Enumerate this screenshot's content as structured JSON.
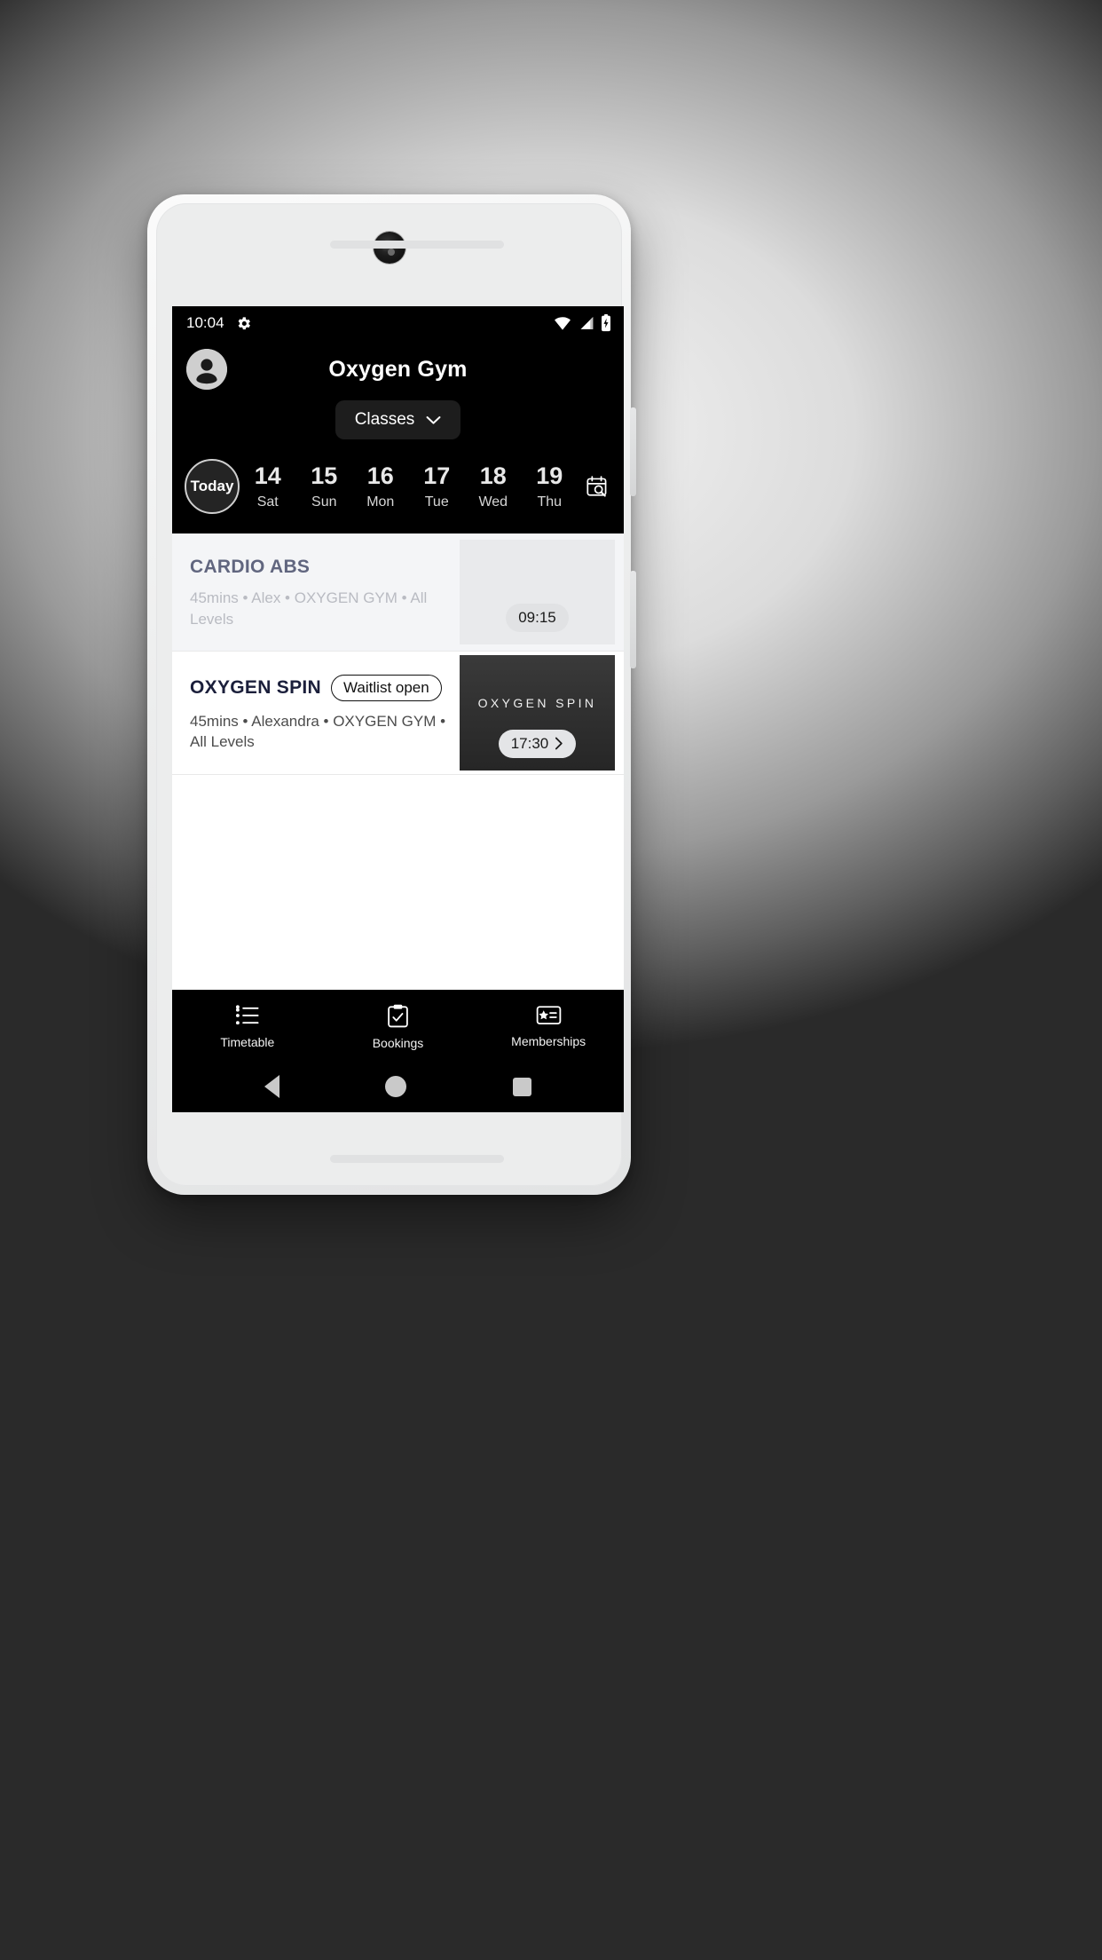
{
  "status_bar": {
    "time": "10:04",
    "icons": [
      "gear-icon",
      "wifi-icon",
      "cellular-signal-icon",
      "battery-charging-icon"
    ]
  },
  "header": {
    "avatar_icon": "account-avatar-icon",
    "title": "Oxygen Gym",
    "filter_button": {
      "label": "Classes",
      "chevron_icon": "chevron-down-icon"
    }
  },
  "date_strip": {
    "today_label": "Today",
    "calendar_search_icon": "calendar-search-icon",
    "days": [
      {
        "num": "14",
        "name": "Sat"
      },
      {
        "num": "15",
        "name": "Sun"
      },
      {
        "num": "16",
        "name": "Mon"
      },
      {
        "num": "17",
        "name": "Tue"
      },
      {
        "num": "18",
        "name": "Wed"
      },
      {
        "num": "19",
        "name": "Thu"
      }
    ]
  },
  "classes": [
    {
      "title": "CARDIO ABS",
      "badge": "",
      "meta": "45mins • Alex • OXYGEN GYM • All Levels",
      "time": "09:15",
      "thumb_text": "",
      "state": "past"
    },
    {
      "title": "OXYGEN SPIN",
      "badge": "Waitlist open",
      "meta": "45mins • Alexandra • OXYGEN GYM • All Levels",
      "time": "17:30",
      "thumb_text": "OXYGEN SPIN",
      "state": "available"
    }
  ],
  "bottom_nav": [
    {
      "label": "Timetable",
      "icon": "list-icon"
    },
    {
      "label": "Bookings",
      "icon": "clipboard-check-icon"
    },
    {
      "label": "Memberships",
      "icon": "membership-card-icon"
    }
  ],
  "android_nav": [
    {
      "name": "back",
      "icon": "triangle-back-icon"
    },
    {
      "name": "home",
      "icon": "circle-home-icon"
    },
    {
      "name": "recents",
      "icon": "square-recents-icon"
    }
  ],
  "colors": {
    "chrome": "#000000",
    "screen_bg": "#ffffff",
    "accent_dark": "#1d1d1d",
    "past_card_bg": "#f4f5f7",
    "title_navy": "#1b1f3b"
  }
}
